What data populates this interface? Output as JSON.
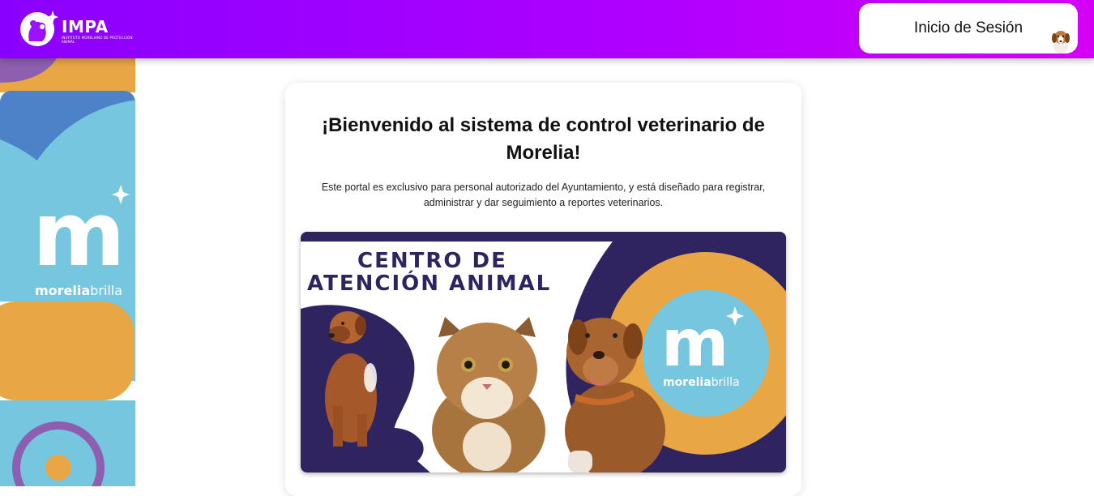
{
  "header": {
    "logo_title": "IMPA",
    "logo_subtitle": "INSTITUTO MORELIANO DE PROTECCIÓN ANIMAL",
    "login_label": "Inicio de Sesión"
  },
  "sidebar": {
    "brand_m": "m",
    "brand_bold": "morelia",
    "brand_light": "brilla"
  },
  "main": {
    "title": "¡Bienvenido al sistema de control veterinario de Morelia!",
    "description": "Este portal es exclusivo para personal autorizado del Ayuntamiento, y está diseñado para registrar, administrar y dar seguimiento a reportes veterinarios."
  },
  "banner": {
    "line1": "CENTRO DE",
    "line2": "ATENCIÓN ANIMAL",
    "brand_m": "m",
    "brand_bold": "morelia",
    "brand_light": "brilla"
  },
  "colors": {
    "header_gradient_start": "#8a00ff",
    "header_gradient_end": "#d400f5",
    "navy": "#2f2460",
    "light_blue": "#76c6df",
    "orange": "#e8a644",
    "purple": "#8e5fb0"
  }
}
